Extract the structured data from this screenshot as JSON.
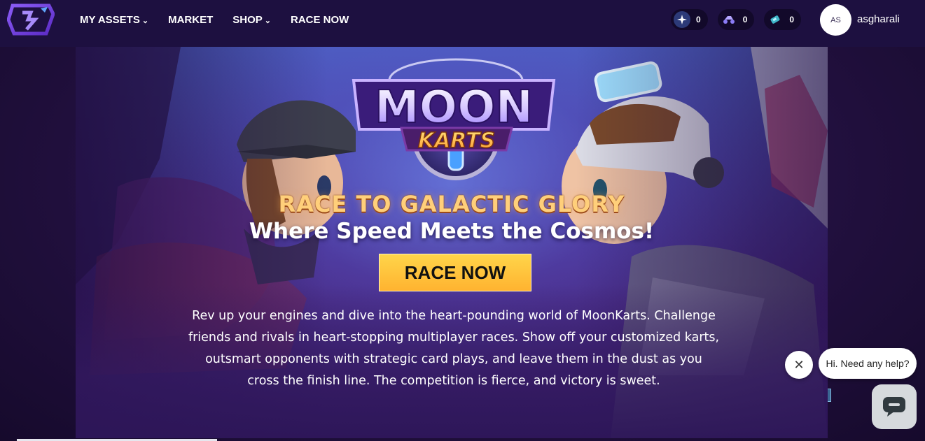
{
  "nav": {
    "items": [
      {
        "label": "MY ASSETS",
        "has_dropdown": true
      },
      {
        "label": "MARKET",
        "has_dropdown": false
      },
      {
        "label": "SHOP",
        "has_dropdown": true
      },
      {
        "label": "RACE NOW",
        "has_dropdown": false
      }
    ],
    "currencies": [
      {
        "icon": "star-token-icon",
        "value": "0"
      },
      {
        "icon": "kart-token-icon",
        "value": "0"
      },
      {
        "icon": "gem-token-icon",
        "value": "0"
      }
    ],
    "user": {
      "initials": "AS",
      "name": "asgharali"
    }
  },
  "hero": {
    "logo_line1": "MOON",
    "logo_line2": "KARTS",
    "tagline": "RACE TO GALACTIC GLORY",
    "subtagline": "Where Speed Meets the Cosmos!",
    "cta_label": "RACE NOW",
    "description": "Rev up your engines and dive into the heart-pounding world of MoonKarts. Challenge friends and rivals in heart-stopping multiplayer races. Show off your customized karts, outsmart opponents with strategic card plays, and leave them in the dust as you cross the finish line. The competition is fierce, and victory is sweet."
  },
  "chat": {
    "greeting": "Hi. Need any help?",
    "close_icon": "close-icon",
    "launcher_icon": "chat-icon"
  },
  "colors": {
    "nav_bg": "#1d1040",
    "cta_bg": "#ffc43d",
    "tagline": "#ffcf7a",
    "accent_purple": "#6a3fd6"
  }
}
